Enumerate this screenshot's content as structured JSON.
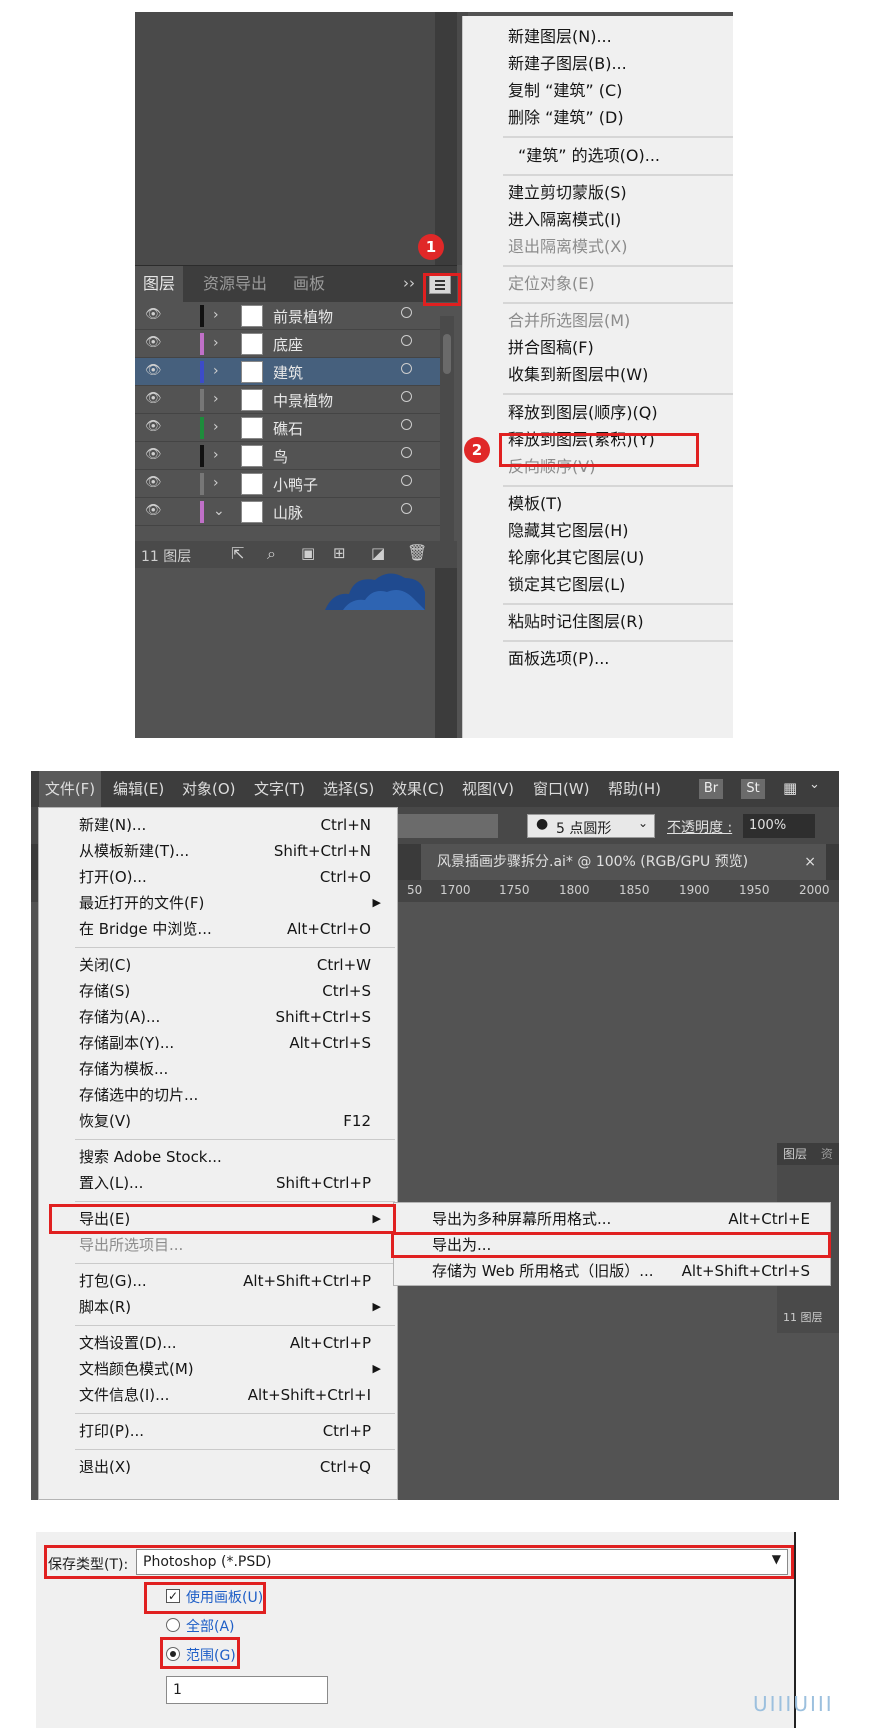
{
  "panel1": {
    "tabs": [
      "图层",
      "资源导出",
      "画板"
    ],
    "expand_icon": "double-chevron-right-icon",
    "menu_icon": "hamburger-menu-icon",
    "badge1": "1",
    "badge2": "2",
    "layers": [
      {
        "name": "前景植物",
        "swatch": "#111111",
        "selected": false,
        "expanded": false
      },
      {
        "name": "底座",
        "swatch": "#c070c8",
        "selected": false,
        "expanded": false
      },
      {
        "name": "建筑",
        "swatch": "#3c4cc8",
        "selected": true,
        "expanded": false
      },
      {
        "name": "中景植物",
        "swatch": "#777777",
        "selected": false,
        "expanded": false
      },
      {
        "name": "礁石",
        "swatch": "#1e8c3c",
        "selected": false,
        "expanded": false
      },
      {
        "name": "鸟",
        "swatch": "#111111",
        "selected": false,
        "expanded": false
      },
      {
        "name": "小鸭子",
        "swatch": "#777777",
        "selected": false,
        "expanded": false
      },
      {
        "name": "山脉",
        "swatch": "#c070c8",
        "selected": false,
        "expanded": true
      }
    ],
    "layer_count": "11 图层",
    "menu": [
      {
        "label": "新建图层(N)...",
        "disabled": false
      },
      {
        "label": "新建子图层(B)...",
        "disabled": false
      },
      {
        "label": "复制 “建筑” (C)",
        "disabled": false
      },
      {
        "label": "删除 “建筑” (D)",
        "disabled": false
      },
      {
        "label": "“建筑” 的选项(O)...",
        "disabled": false
      },
      {
        "label": "建立剪切蒙版(S)",
        "disabled": false
      },
      {
        "label": "进入隔离模式(I)",
        "disabled": false
      },
      {
        "label": "退出隔离模式(X)",
        "disabled": true
      },
      {
        "label": "定位对象(E)",
        "disabled": true
      },
      {
        "label": "合并所选图层(M)",
        "disabled": true
      },
      {
        "label": "拼合图稿(F)",
        "disabled": false
      },
      {
        "label": "收集到新图层中(W)",
        "disabled": false
      },
      {
        "label": "释放到图层(顺序)(Q)",
        "disabled": false
      },
      {
        "label": "释放到图层(累积)(Y)",
        "disabled": false
      },
      {
        "label": "反向顺序(V)",
        "disabled": true
      },
      {
        "label": "模板(T)",
        "disabled": false
      },
      {
        "label": "隐藏其它图层(H)",
        "disabled": false
      },
      {
        "label": "轮廓化其它图层(U)",
        "disabled": false
      },
      {
        "label": "锁定其它图层(L)",
        "disabled": false
      },
      {
        "label": "粘贴时记住图层(R)",
        "disabled": false
      },
      {
        "label": "面板选项(P)...",
        "disabled": false
      }
    ]
  },
  "panel2": {
    "menubar": [
      "文件(F)",
      "编辑(E)",
      "对象(O)",
      "文字(T)",
      "选择(S)",
      "效果(C)",
      "视图(V)",
      "窗口(W)",
      "帮助(H)"
    ],
    "br": "Br",
    "st": "St",
    "brush": "5 点圆形",
    "opacity_label": "不透明度 :",
    "opacity_value": "100%",
    "doc_tab": "风景插画步骤拆分.ai* @ 100% (RGB/GPU 预览)",
    "doc_close": "×",
    "ruler": [
      "50",
      "1700",
      "1750",
      "1800",
      "1850",
      "1900",
      "1950",
      "2000"
    ],
    "file_menu": [
      {
        "label": "新建(N)...",
        "shortcut": "Ctrl+N",
        "arrow": false,
        "disabled": false
      },
      {
        "label": "从模板新建(T)...",
        "shortcut": "Shift+Ctrl+N",
        "arrow": false,
        "disabled": false
      },
      {
        "label": "打开(O)...",
        "shortcut": "Ctrl+O",
        "arrow": false,
        "disabled": false
      },
      {
        "label": "最近打开的文件(F)",
        "shortcut": "",
        "arrow": true,
        "disabled": false
      },
      {
        "label": "在 Bridge 中浏览...",
        "shortcut": "Alt+Ctrl+O",
        "arrow": false,
        "disabled": false
      },
      {
        "label": "关闭(C)",
        "shortcut": "Ctrl+W",
        "arrow": false,
        "disabled": false
      },
      {
        "label": "存储(S)",
        "shortcut": "Ctrl+S",
        "arrow": false,
        "disabled": false
      },
      {
        "label": "存储为(A)...",
        "shortcut": "Shift+Ctrl+S",
        "arrow": false,
        "disabled": false
      },
      {
        "label": "存储副本(Y)...",
        "shortcut": "Alt+Ctrl+S",
        "arrow": false,
        "disabled": false
      },
      {
        "label": "存储为模板...",
        "shortcut": "",
        "arrow": false,
        "disabled": false
      },
      {
        "label": "存储选中的切片...",
        "shortcut": "",
        "arrow": false,
        "disabled": false
      },
      {
        "label": "恢复(V)",
        "shortcut": "F12",
        "arrow": false,
        "disabled": false
      },
      {
        "label": "搜索 Adobe Stock...",
        "shortcut": "",
        "arrow": false,
        "disabled": false
      },
      {
        "label": "置入(L)...",
        "shortcut": "Shift+Ctrl+P",
        "arrow": false,
        "disabled": false
      },
      {
        "label": "导出(E)",
        "shortcut": "",
        "arrow": true,
        "disabled": false
      },
      {
        "label": "导出所选项目...",
        "shortcut": "",
        "arrow": false,
        "disabled": true
      },
      {
        "label": "打包(G)...",
        "shortcut": "Alt+Shift+Ctrl+P",
        "arrow": false,
        "disabled": false
      },
      {
        "label": "脚本(R)",
        "shortcut": "",
        "arrow": true,
        "disabled": false
      },
      {
        "label": "文档设置(D)...",
        "shortcut": "Alt+Ctrl+P",
        "arrow": false,
        "disabled": false
      },
      {
        "label": "文档颜色模式(M)",
        "shortcut": "",
        "arrow": true,
        "disabled": false
      },
      {
        "label": "文件信息(I)...",
        "shortcut": "Alt+Shift+Ctrl+I",
        "arrow": false,
        "disabled": false
      },
      {
        "label": "打印(P)...",
        "shortcut": "Ctrl+P",
        "arrow": false,
        "disabled": false
      },
      {
        "label": "退出(X)",
        "shortcut": "Ctrl+Q",
        "arrow": false,
        "disabled": false
      }
    ],
    "export_submenu": [
      {
        "label": "导出为多种屏幕所用格式...",
        "shortcut": "Alt+Ctrl+E"
      },
      {
        "label": "导出为...",
        "shortcut": ""
      },
      {
        "label": "存储为 Web 所用格式（旧版）...",
        "shortcut": "Alt+Shift+Ctrl+S"
      }
    ],
    "mini_panel": {
      "tab1": "图层",
      "tab2": "资",
      "count": "11 图层"
    }
  },
  "panel3": {
    "save_type_label": "保存类型(T):",
    "save_type_value": "Photoshop (*.PSD)",
    "use_artboard": "使用画板(U)",
    "all": "全部(A)",
    "range": "范围(G):",
    "range_value": "1"
  },
  "watermark": "UIIIUIII",
  "colors": {
    "accent_red": "#e02020",
    "selection_blue": "#46607d",
    "link_blue": "#1f5fc7"
  }
}
